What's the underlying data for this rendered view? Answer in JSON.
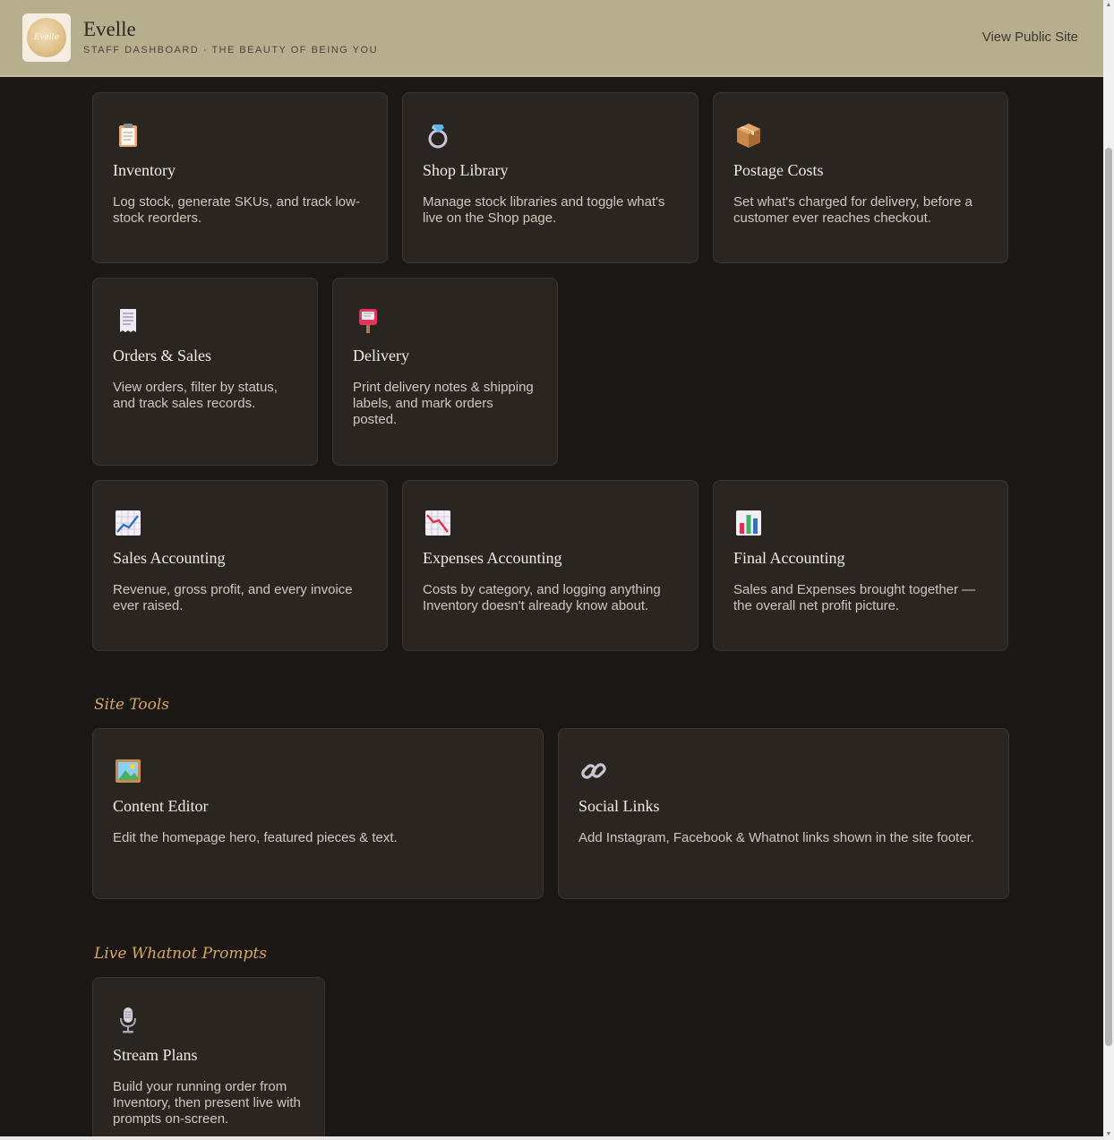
{
  "header": {
    "logo_text": "Evelle",
    "brand_name": "Evelle",
    "brand_subtitle": "STAFF DASHBOARD · THE BEAUTY OF BEING YOU",
    "view_public": "View Public Site"
  },
  "cards": {
    "inventory": {
      "icon": "clipboard-icon",
      "title": "Inventory",
      "desc": "Log stock, generate SKUs, and track low-stock reorders."
    },
    "shop_library": {
      "icon": "ring-icon",
      "title": "Shop Library",
      "desc": "Manage stock libraries and toggle what's live on the Shop page."
    },
    "postage": {
      "icon": "package-icon",
      "title": "Postage Costs",
      "desc": "Set what's charged for delivery, before a customer ever reaches checkout."
    },
    "orders": {
      "icon": "receipt-icon",
      "title": "Orders & Sales",
      "desc": "View orders, filter by status, and track sales records."
    },
    "delivery": {
      "icon": "postbox-icon",
      "title": "Delivery",
      "desc": "Print delivery notes & shipping labels, and mark orders posted."
    },
    "sales_accounting": {
      "icon": "chart-up-icon",
      "title": "Sales Accounting",
      "desc": "Revenue, gross profit, and every invoice ever raised."
    },
    "expenses_accounting": {
      "icon": "chart-down-icon",
      "title": "Expenses Accounting",
      "desc": "Costs by category, and logging anything Inventory doesn't already know about."
    },
    "final_accounting": {
      "icon": "bar-chart-icon",
      "title": "Final Accounting",
      "desc": "Sales and Expenses brought together — the overall net profit picture."
    },
    "content_editor": {
      "icon": "picture-icon",
      "title": "Content Editor",
      "desc": "Edit the homepage hero, featured pieces & text."
    },
    "social_links": {
      "icon": "link-icon",
      "title": "Social Links",
      "desc": "Add Instagram, Facebook & Whatnot links shown in the site footer."
    },
    "stream_plans": {
      "icon": "microphone-icon",
      "title": "Stream Plans",
      "desc": "Build your running order from Inventory, then present live with prompts on-screen."
    }
  },
  "sections": {
    "site_tools": "Site Tools",
    "live_whatnot": "Live Whatnot Prompts"
  }
}
